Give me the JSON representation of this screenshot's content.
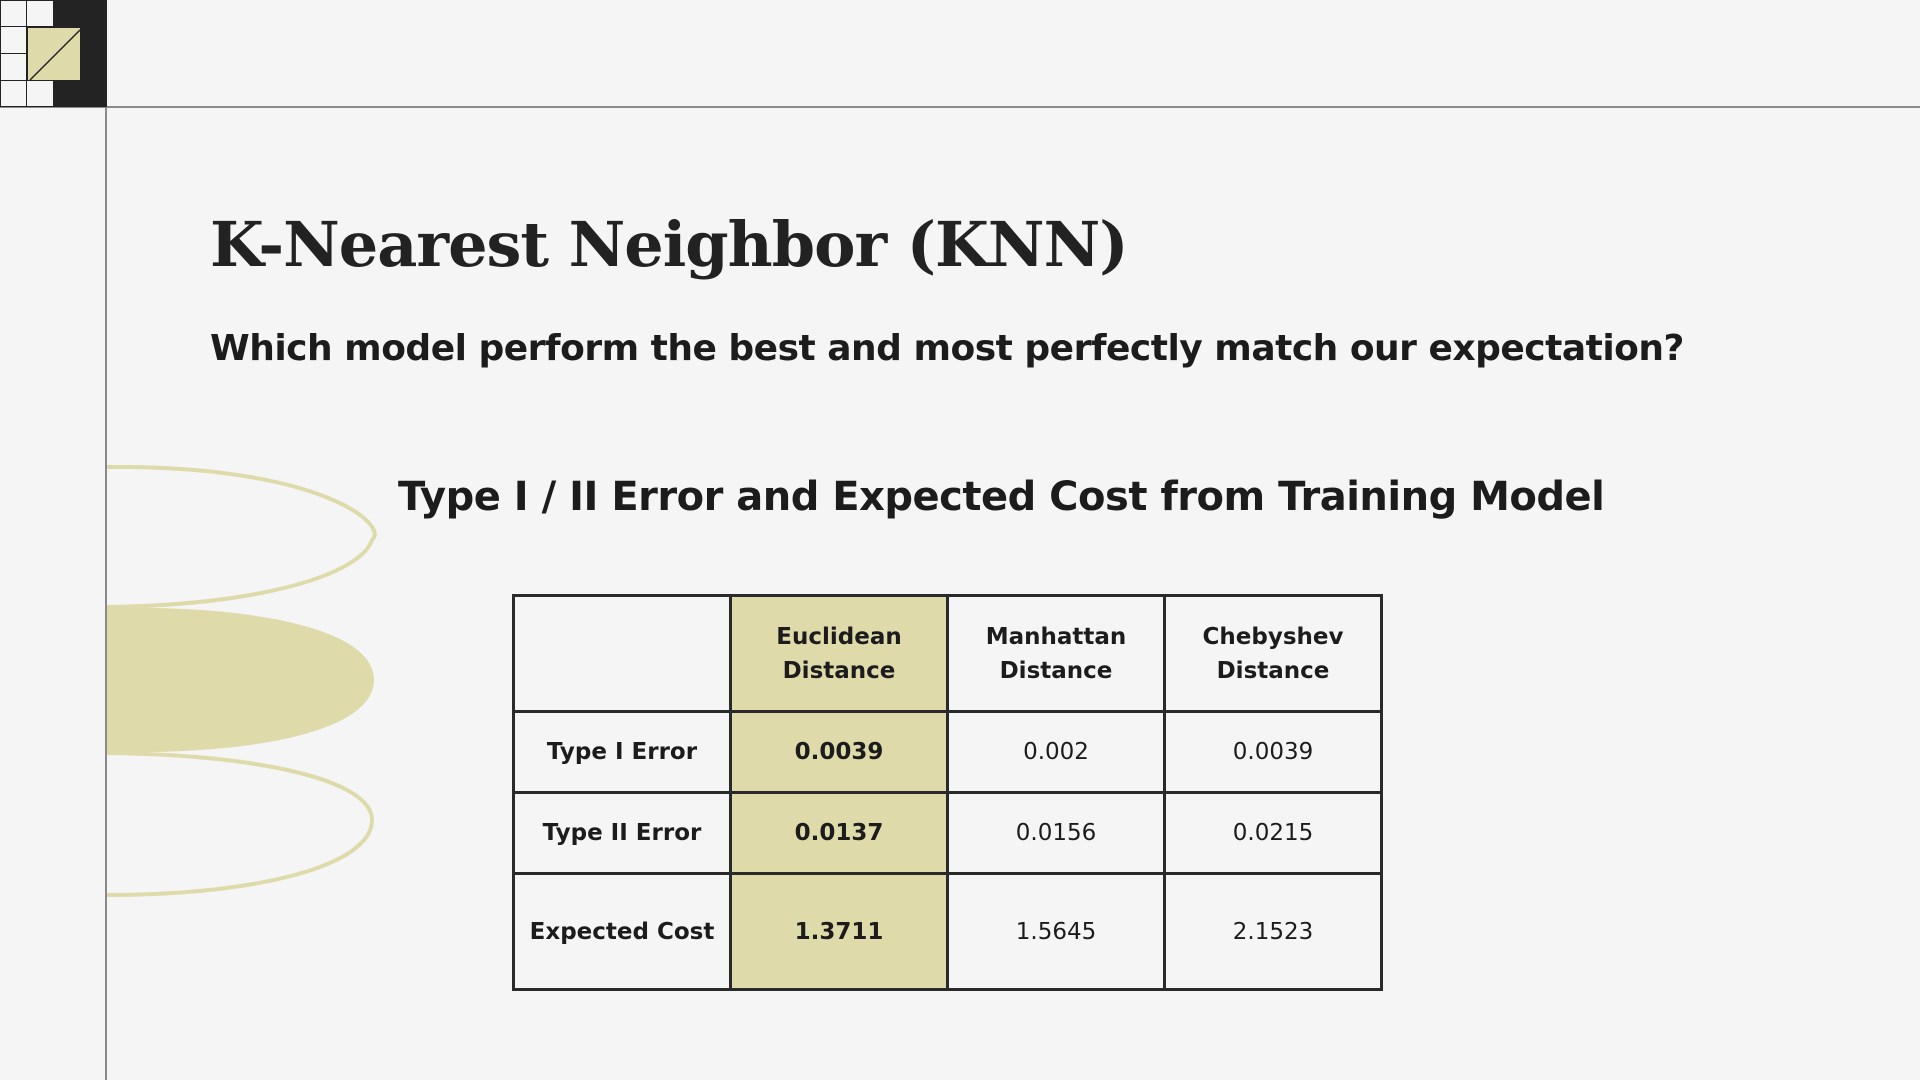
{
  "title": "K-Nearest Neighbor (KNN)",
  "subtitle": "Which model perform the best and most perfectly match our expectation?",
  "table_heading": "Type I / II Error and Expected Cost from Training Model",
  "colors": {
    "accent": "#dedaaa",
    "text": "#1c1c1c",
    "background": "#f5f5f5",
    "frame": "#232323"
  },
  "table": {
    "columns": [
      "",
      "Euclidean Distance",
      "Manhattan Distance",
      "Chebyshev Distance"
    ],
    "highlight_column": "Euclidean Distance",
    "rows": [
      {
        "label": "Type I Error",
        "values": [
          "0.0039",
          "0.002",
          "0.0039"
        ]
      },
      {
        "label": "Type II Error",
        "values": [
          "0.0137",
          "0.0156",
          "0.0215"
        ]
      },
      {
        "label": "Expected Cost",
        "values": [
          "1.3711",
          "1.5645",
          "2.1523"
        ]
      }
    ]
  }
}
